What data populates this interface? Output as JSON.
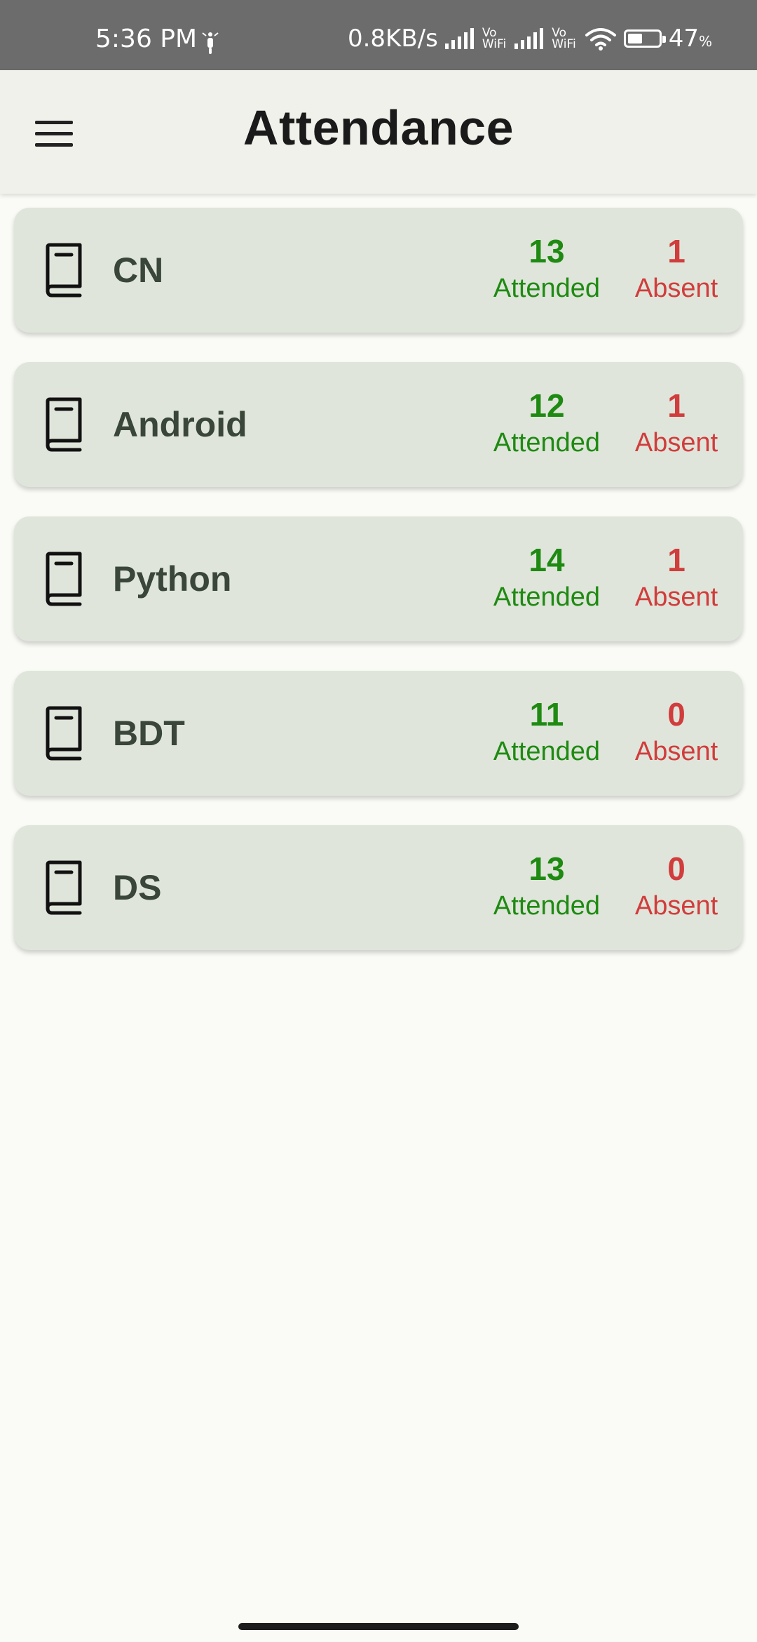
{
  "status_bar": {
    "time": "5:36 PM",
    "net_speed": "0.8KB/s",
    "vowifi_top": "Vo",
    "vowifi_bottom": "WiFi",
    "battery_percent": "47",
    "percent_sign": "%",
    "battery_level": 0.47,
    "icons": [
      "scooter-icon",
      "signal-icon",
      "vowifi-icon",
      "wifi-icon",
      "battery-icon"
    ]
  },
  "app_bar": {
    "title": "Attendance",
    "menu_icon": "hamburger-menu-icon"
  },
  "colors": {
    "attended": "#1e8a12",
    "absent": "#d13c3c",
    "card_bg": "#dfe5da",
    "subject_text": "#3a4639"
  },
  "subjects": [
    {
      "name": "CN",
      "attended": "13",
      "attended_label": "Attended",
      "absent": "1",
      "absent_label": "Absent",
      "icon": "book-icon"
    },
    {
      "name": "Android",
      "attended": "12",
      "attended_label": "Attended",
      "absent": "1",
      "absent_label": "Absent",
      "icon": "book-icon"
    },
    {
      "name": "Python",
      "attended": "14",
      "attended_label": "Attended",
      "absent": "1",
      "absent_label": "Absent",
      "icon": "book-icon"
    },
    {
      "name": "BDT",
      "attended": "11",
      "attended_label": "Attended",
      "absent": "0",
      "absent_label": "Absent",
      "icon": "book-icon"
    },
    {
      "name": "DS",
      "attended": "13",
      "attended_label": "Attended",
      "absent": "0",
      "absent_label": "Absent",
      "icon": "book-icon"
    }
  ]
}
